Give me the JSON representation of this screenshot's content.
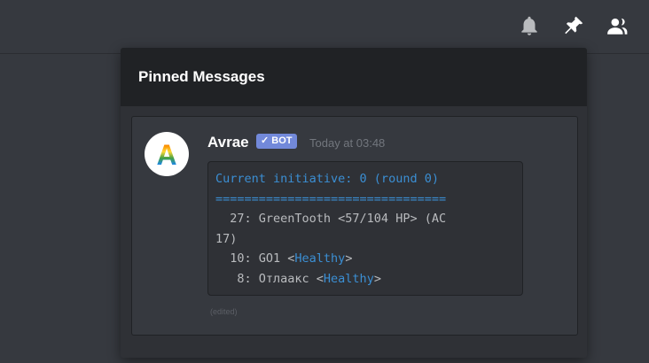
{
  "popout": {
    "title": "Pinned Messages"
  },
  "message": {
    "author": "Avrae",
    "bot_tag": "✓ BOT",
    "timestamp": "Today at 03:48",
    "avatar_letter": "A",
    "edited_label": "(edited)",
    "code_lines": [
      {
        "parts": [
          {
            "text": "Current initiative: 0 (round 0)",
            "color": "blue"
          }
        ]
      },
      {
        "parts": [
          {
            "text": "================================",
            "color": "blue"
          }
        ]
      },
      {
        "parts": [
          {
            "text": "  27: GreenTooth <57/104 HP> (AC",
            "color": "default"
          }
        ]
      },
      {
        "parts": [
          {
            "text": "17)",
            "color": "default"
          }
        ]
      },
      {
        "parts": [
          {
            "text": "  10: GO1 <",
            "color": "default"
          },
          {
            "text": "Healthy",
            "color": "blue"
          },
          {
            "text": ">",
            "color": "default"
          }
        ]
      },
      {
        "parts": [
          {
            "text": "   8: Отлаакс <",
            "color": "default"
          },
          {
            "text": "Healthy",
            "color": "blue"
          },
          {
            "text": ">",
            "color": "default"
          }
        ]
      }
    ]
  },
  "toolbar": {
    "icons": [
      "bell-icon",
      "pin-icon",
      "members-icon"
    ]
  },
  "colors": {
    "background": "#36393f",
    "popout": "#2f3136",
    "header": "#202225",
    "bot_tag": "#7289da",
    "code_blue": "#3b8fd4"
  }
}
